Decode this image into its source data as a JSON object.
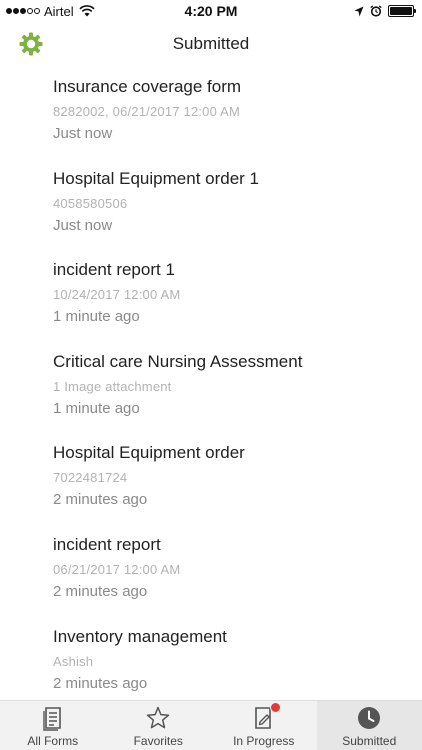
{
  "status_bar": {
    "carrier": "Airtel",
    "time": "4:20 PM"
  },
  "nav": {
    "title": "Submitted",
    "settings_icon": "gear-icon",
    "accent_color": "#7cb342"
  },
  "submissions": [
    {
      "title": "Insurance coverage form",
      "detail": "8282002,  06/21/2017 12:00 AM",
      "time": "Just now"
    },
    {
      "title": "Hospital Equipment order 1",
      "detail": "4058580506",
      "time": "Just now"
    },
    {
      "title": "incident report 1",
      "detail": "10/24/2017 12:00 AM",
      "time": "1 minute ago"
    },
    {
      "title": "Critical care Nursing Assessment",
      "detail": "1 Image attachment",
      "time": "1 minute ago"
    },
    {
      "title": "Hospital Equipment order",
      "detail": "7022481724",
      "time": "2 minutes ago"
    },
    {
      "title": "incident report",
      "detail": "06/21/2017 12:00 AM",
      "time": "2 minutes ago"
    },
    {
      "title": "Inventory management",
      "detail": "Ashish",
      "time": "2 minutes ago"
    }
  ],
  "tabs": [
    {
      "label": "All Forms",
      "icon": "document-icon"
    },
    {
      "label": "Favorites",
      "icon": "star-icon"
    },
    {
      "label": "In Progress",
      "icon": "edit-form-icon"
    },
    {
      "label": "Submitted",
      "icon": "clock-icon",
      "active": true
    }
  ],
  "colors": {
    "badge": "#e53935",
    "tab_icon": "#555555"
  }
}
